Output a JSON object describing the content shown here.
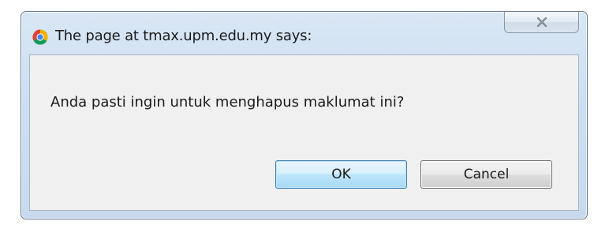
{
  "dialog": {
    "title": "The page at tmax.upm.edu.my says:",
    "message": "Anda pasti ingin untuk menghapus maklumat ini?",
    "buttons": {
      "ok_label": "OK",
      "cancel_label": "Cancel"
    },
    "icons": {
      "app": "chrome-browser-icon",
      "close": "close-icon"
    }
  }
}
